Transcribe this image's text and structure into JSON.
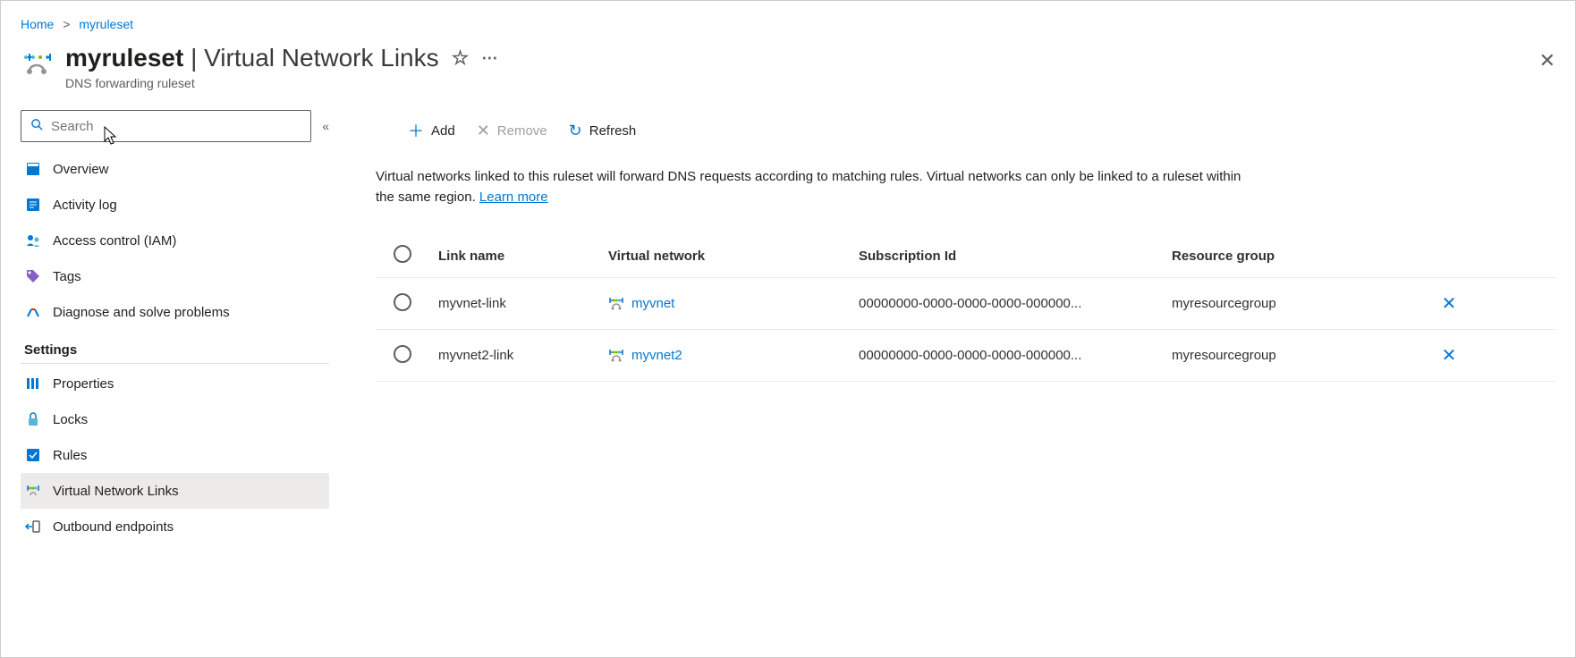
{
  "breadcrumb": {
    "home": "Home",
    "resource": "myruleset"
  },
  "header": {
    "title_bold": "myruleset",
    "title_rest": "Virtual Network Links",
    "subtitle": "DNS forwarding ruleset"
  },
  "search": {
    "placeholder": "Search"
  },
  "sidebar": {
    "items": [
      {
        "label": "Overview",
        "icon": "overview"
      },
      {
        "label": "Activity log",
        "icon": "activity"
      },
      {
        "label": "Access control (IAM)",
        "icon": "iam"
      },
      {
        "label": "Tags",
        "icon": "tags"
      },
      {
        "label": "Diagnose and solve problems",
        "icon": "diagnose"
      }
    ],
    "section_label": "Settings",
    "settings": [
      {
        "label": "Properties",
        "icon": "properties"
      },
      {
        "label": "Locks",
        "icon": "locks"
      },
      {
        "label": "Rules",
        "icon": "rules"
      },
      {
        "label": "Virtual Network Links",
        "icon": "vnetlinks",
        "selected": true
      },
      {
        "label": "Outbound endpoints",
        "icon": "outbound"
      }
    ]
  },
  "toolbar": {
    "add": "Add",
    "remove": "Remove",
    "refresh": "Refresh"
  },
  "description": {
    "text": "Virtual networks linked to this ruleset will forward DNS requests according to matching rules. Virtual networks can only be linked to a ruleset within the same region. ",
    "learn_more": "Learn more"
  },
  "table": {
    "headers": {
      "link": "Link name",
      "vnet": "Virtual network",
      "sub": "Subscription Id",
      "rg": "Resource group"
    },
    "rows": [
      {
        "link": "myvnet-link",
        "vnet": "myvnet",
        "sub": "00000000-0000-0000-0000-000000...",
        "rg": "myresourcegroup"
      },
      {
        "link": "myvnet2-link",
        "vnet": "myvnet2",
        "sub": "00000000-0000-0000-0000-000000...",
        "rg": "myresourcegroup"
      }
    ]
  }
}
